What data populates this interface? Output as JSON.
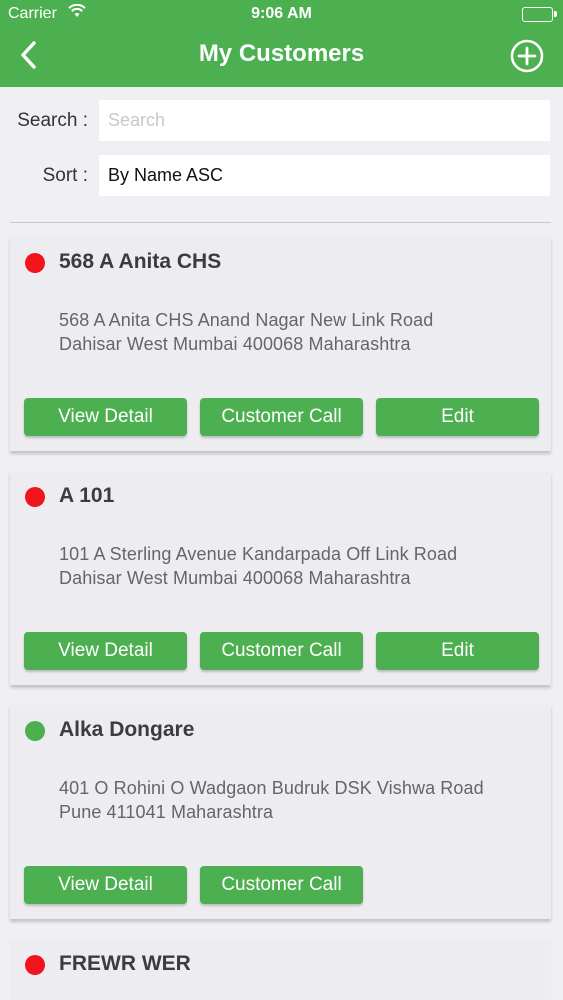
{
  "status_bar": {
    "carrier": "Carrier",
    "time": "9:06 AM"
  },
  "header": {
    "title": "My Customers",
    "back_icon": "chevron-left-icon",
    "add_icon": "plus-circle-icon"
  },
  "search": {
    "label": "Search :",
    "placeholder": "Search",
    "value": ""
  },
  "sort": {
    "label": "Sort :",
    "value": "By Name ASC"
  },
  "colors": {
    "brand": "#4caf50",
    "status_red": "#f0141c",
    "status_green": "#4caf50"
  },
  "customers": [
    {
      "name": "568 A Anita CHS",
      "status_color": "#f0141c",
      "address_line1": "568 A Anita CHS Anand Nagar New Link Road",
      "address_line2": "Dahisar West Mumbai 400068 Maharashtra",
      "view_label": "View Detail",
      "call_label": "Customer Call",
      "edit_label": "Edit"
    },
    {
      "name": "A 101",
      "status_color": "#f0141c",
      "address_line1": "101 A Sterling Avenue Kandarpada Off Link Road",
      "address_line2": "Dahisar West Mumbai 400068 Maharashtra",
      "view_label": "View Detail",
      "call_label": "Customer Call",
      "edit_label": "Edit"
    },
    {
      "name": "Alka Dongare",
      "status_color": "#4caf50",
      "address_line1": "401 O Rohini O Wadgaon Budruk DSK Vishwa Road",
      "address_line2": "Pune 411041 Maharashtra",
      "view_label": "View Detail",
      "call_label": "Customer Call"
    },
    {
      "name": "FREWR WER",
      "status_color": "#f0141c"
    }
  ]
}
